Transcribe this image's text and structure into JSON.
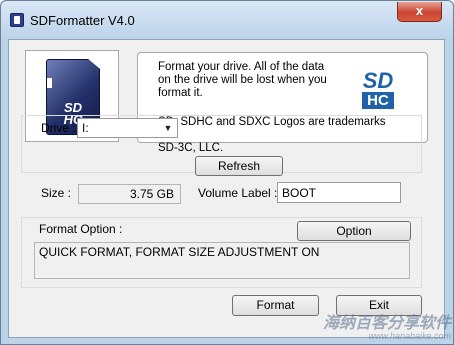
{
  "window": {
    "title": "SDFormatter V4.0",
    "close_glyph": "x"
  },
  "card_image": {
    "icon": "sd-card-icon",
    "logo_text": "SD HC"
  },
  "info": {
    "message": "Format your drive. All of the data\non the drive will be lost when you\nformat it.",
    "trademark": "SD, SDHC and SDXC Logos are trademarks of\nSD-3C, LLC.",
    "logo_sd": "SD",
    "logo_hc": "HC",
    "logo_color": "#1f62a8"
  },
  "drive": {
    "drive_label": "Drive :",
    "drive_value": "I:",
    "refresh_label": "Refresh",
    "size_label": "Size :",
    "size_value": "3.75 GB",
    "volume_label": "Volume Label :",
    "volume_value": "BOOT"
  },
  "format_option": {
    "label": "Format Option :",
    "option_button": "Option",
    "current": "QUICK FORMAT, FORMAT SIZE ADJUSTMENT ON"
  },
  "actions": {
    "format_label": "Format",
    "exit_label": "Exit"
  },
  "watermark": {
    "text": "海纳百客分享软件",
    "url": "www.hanabaike.com"
  }
}
